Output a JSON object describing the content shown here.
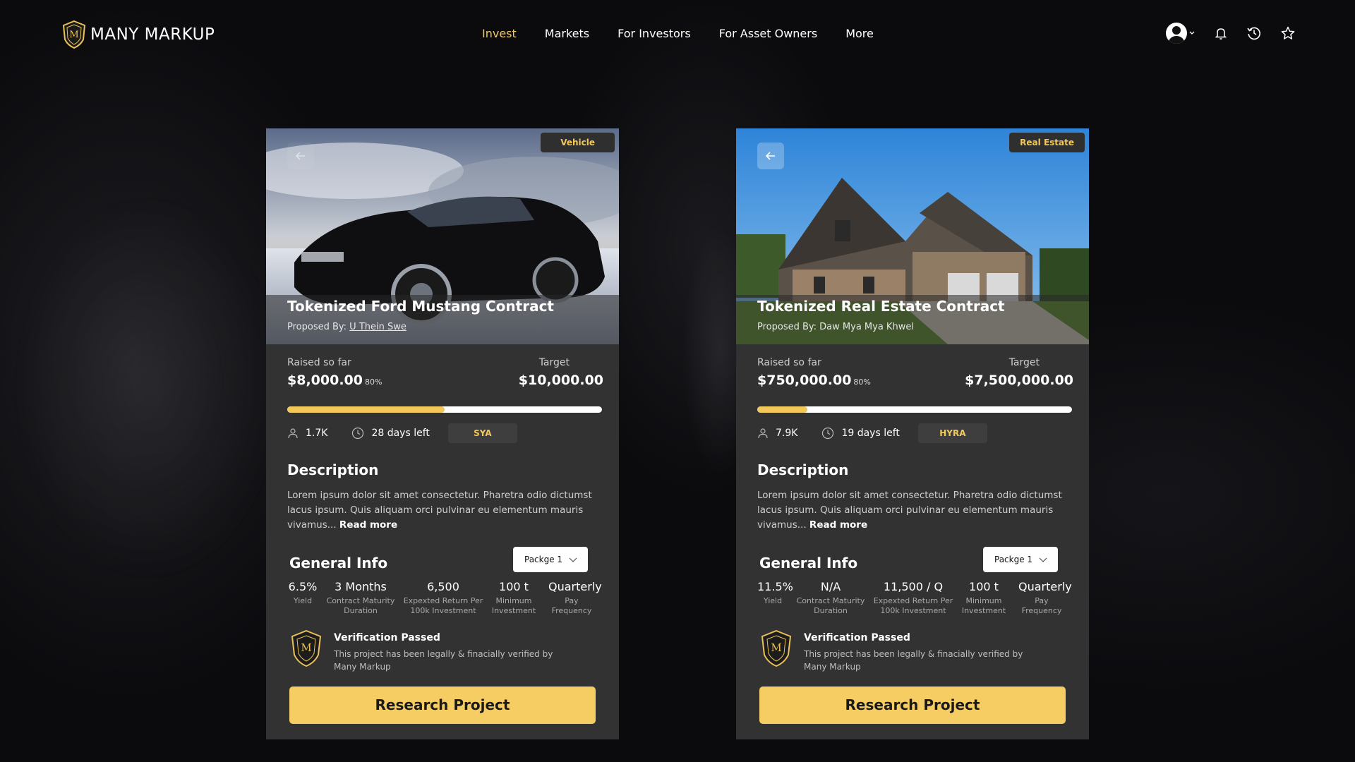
{
  "brand": {
    "name": "MANY MARKUP"
  },
  "nav": {
    "items": [
      {
        "label": "Invest",
        "active": true
      },
      {
        "label": "Markets"
      },
      {
        "label": "For Investors"
      },
      {
        "label": "For Asset Owners"
      },
      {
        "label": "More"
      }
    ]
  },
  "colors": {
    "accent": "#f3c85a",
    "card": "#323232",
    "background": "#0b0b0e",
    "button": "#f5cd63"
  },
  "cards": [
    {
      "badge": "Vehicle",
      "title": "Tokenized Ford Mustang Contract",
      "proposed_prefix": "Proposed By:",
      "proposer": "U Thein Swe",
      "raised_label": "Raised so far",
      "raised": "$8,000.00",
      "raised_pct": "80%",
      "target_label": "Target",
      "target": "$10,000.00",
      "progress": 0.5,
      "investors": "1.7K",
      "days_left": "28 days left",
      "ticker": "SYA",
      "desc_heading": "Description",
      "description": "Lorem ipsum dolor sit amet consectetur. Pharetra odio dictumst lacus ipsum. Quis aliquam orci pulvinar eu elementum mauris vivamus...",
      "read_more": "Read more",
      "info_heading": "General Info",
      "package": "Packge 1",
      "stats": [
        {
          "value": "6.5%",
          "label": "Yield"
        },
        {
          "value": "3 Months",
          "label": "Contract Maturity Duration"
        },
        {
          "value": "6,500",
          "label": "Expexted Return Per 100k Investment"
        },
        {
          "value": "100 t",
          "label": "Minimum Investment"
        },
        {
          "value": "Quarterly",
          "label": "Pay Frequency"
        }
      ],
      "verify_title": "Verification Passed",
      "verify_text": "This project has been legally & finacially verified by Many Markup",
      "cta": "Research Project"
    },
    {
      "badge": "Real Estate",
      "title": "Tokenized Real Estate Contract",
      "proposed_prefix": "Proposed By:",
      "proposer": "Daw Mya Mya Khwel",
      "raised_label": "Raised so far",
      "raised": "$750,000.00",
      "raised_pct": "80%",
      "target_label": "Target",
      "target": "$7,500,000.00",
      "progress": 0.16,
      "investors": "7.9K",
      "days_left": "19 days left",
      "ticker": "HYRA",
      "desc_heading": "Description",
      "description": "Lorem ipsum dolor sit amet consectetur. Pharetra odio dictumst lacus ipsum. Quis aliquam orci pulvinar eu elementum mauris vivamus...",
      "read_more": "Read more",
      "info_heading": "General Info",
      "package": "Packge 1",
      "stats": [
        {
          "value": "11.5%",
          "label": "Yield"
        },
        {
          "value": "N/A",
          "label": "Contract Maturity Duration"
        },
        {
          "value": "11,500 / Q",
          "label": "Expexted Return Per 100k Investment"
        },
        {
          "value": "100 t",
          "label": "Minimum Investment"
        },
        {
          "value": "Quarterly",
          "label": "Pay Frequency"
        }
      ],
      "verify_title": "Verification Passed",
      "verify_text": "This project has been legally & finacially verified by Many Markup",
      "cta": "Research Project"
    }
  ],
  "icons": [
    "shield-logo-icon",
    "avatar-icon",
    "chevron-down-icon",
    "bell-icon",
    "history-icon",
    "star-icon",
    "back-arrow-icon",
    "user-icon",
    "clock-icon"
  ]
}
